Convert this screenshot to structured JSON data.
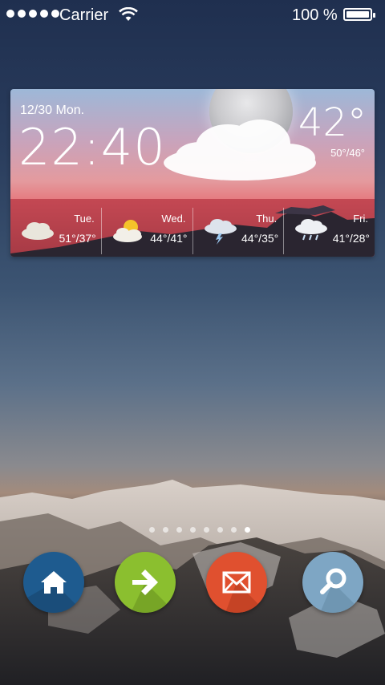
{
  "status": {
    "carrier": "Carrier",
    "battery_percent": "100 %",
    "signal_bars": 5,
    "battery_level": 1.0
  },
  "widget": {
    "date": "12/30 Mon.",
    "time": "22:40",
    "current_temp": "42°",
    "current_range": "50°/46°",
    "forecast": [
      {
        "day": "Tue.",
        "temps": "51°/37°",
        "icon": "cloudy-icon"
      },
      {
        "day": "Wed.",
        "temps": "44°/41°",
        "icon": "partly-sunny-icon"
      },
      {
        "day": "Thu.",
        "temps": "44°/35°",
        "icon": "thunderstorm-icon"
      },
      {
        "day": "Fri.",
        "temps": "41°/28°",
        "icon": "rain-cloud-icon"
      }
    ]
  },
  "pager": {
    "total": 8,
    "active_index": 7
  },
  "dock": [
    {
      "name": "home-icon",
      "color": "#1e5b8f"
    },
    {
      "name": "arrow-right-icon",
      "color": "#8bbf2f"
    },
    {
      "name": "mail-icon",
      "color": "#e0502f"
    },
    {
      "name": "search-icon",
      "color": "#7ea6c4"
    }
  ]
}
